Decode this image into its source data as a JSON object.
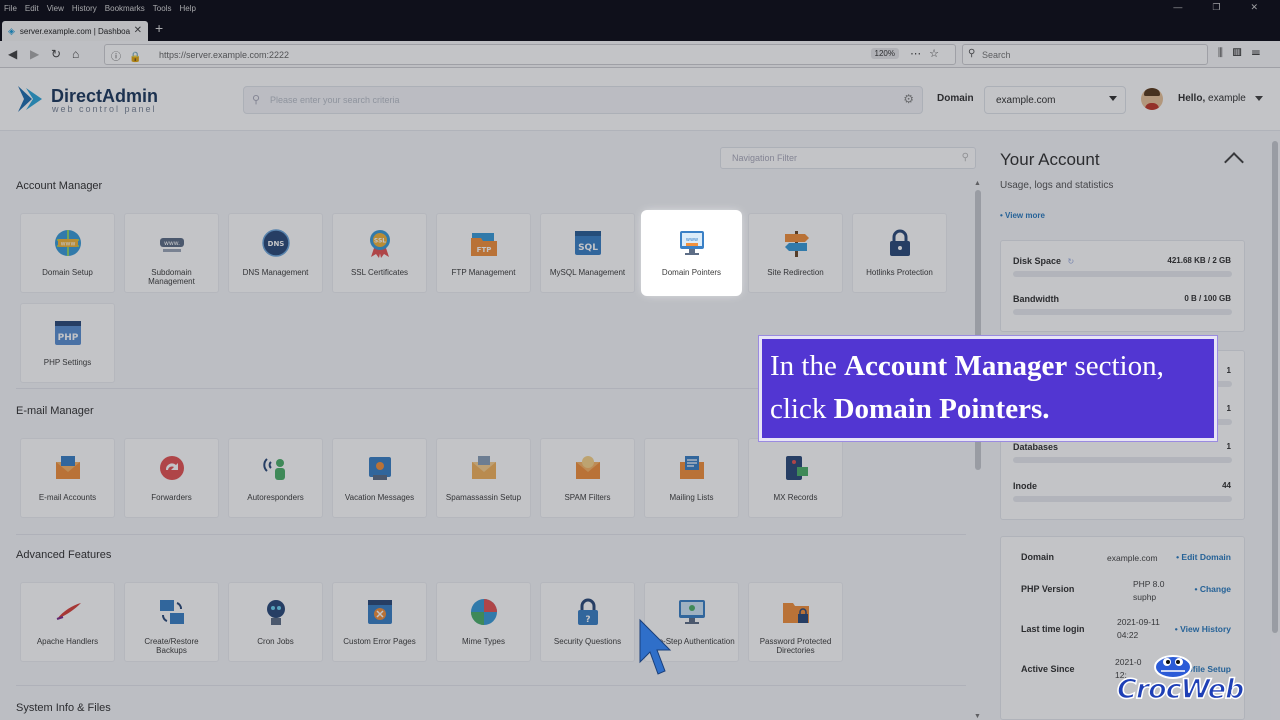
{
  "browser": {
    "menu": [
      "File",
      "Edit",
      "View",
      "History",
      "Bookmarks",
      "Tools",
      "Help"
    ],
    "tab_title": "server.example.com | Dashboa",
    "url": "https://server.example.com:2222",
    "zoom": "120%",
    "search_placeholder": "Search"
  },
  "header": {
    "logo_name": "DirectAdmin",
    "logo_sub": "web control panel",
    "search_placeholder": "Please enter your search criteria",
    "domain_label": "Domain",
    "domain_value": "example.com",
    "hello_prefix": "Hello,",
    "hello_user": "example"
  },
  "nav_filter_placeholder": "Navigation Filter",
  "sections": {
    "account": {
      "title": "Account Manager",
      "items": [
        {
          "label": "Domain Setup",
          "icon": "globe-www-icon"
        },
        {
          "label": "Subdomain Management",
          "icon": "subdomain-icon"
        },
        {
          "label": "DNS Management",
          "icon": "dns-globe-icon"
        },
        {
          "label": "SSL Certificates",
          "icon": "ssl-badge-icon"
        },
        {
          "label": "FTP Management",
          "icon": "ftp-folder-icon"
        },
        {
          "label": "MySQL Management",
          "icon": "sql-window-icon"
        },
        {
          "label": "Domain Pointers",
          "icon": "domain-pointer-monitor-icon"
        },
        {
          "label": "Site Redirection",
          "icon": "signpost-icon"
        },
        {
          "label": "Hotlinks Protection",
          "icon": "padlock-icon"
        },
        {
          "label": "PHP Settings",
          "icon": "php-window-icon"
        }
      ]
    },
    "email": {
      "title": "E-mail Manager",
      "items": [
        {
          "label": "E-mail Accounts",
          "icon": "envelope-icon"
        },
        {
          "label": "Forwarders",
          "icon": "forward-arrow-icon"
        },
        {
          "label": "Autoresponders",
          "icon": "auto-responder-icon"
        },
        {
          "label": "Vacation Messages",
          "icon": "vacation-icon"
        },
        {
          "label": "Spamassassin Setup",
          "icon": "spam-envelope-icon"
        },
        {
          "label": "SPAM Filters",
          "icon": "spam-filter-icon"
        },
        {
          "label": "Mailing Lists",
          "icon": "mailing-list-icon"
        },
        {
          "label": "MX Records",
          "icon": "mx-server-icon"
        }
      ]
    },
    "advanced": {
      "title": "Advanced Features",
      "items": [
        {
          "label": "Apache Handlers",
          "icon": "apache-feather-icon"
        },
        {
          "label": "Create/Restore Backups",
          "icon": "backup-icon"
        },
        {
          "label": "Cron Jobs",
          "icon": "cron-robot-icon"
        },
        {
          "label": "Custom Error Pages",
          "icon": "error-page-icon"
        },
        {
          "label": "Mime Types",
          "icon": "mime-types-icon"
        },
        {
          "label": "Security Questions",
          "icon": "security-lock-icon"
        },
        {
          "label": "Two-Step Authentication",
          "icon": "two-step-monitor-icon"
        },
        {
          "label": "Password Protected Directories",
          "icon": "protected-folder-icon"
        }
      ]
    },
    "system": {
      "title": "System Info & Files"
    }
  },
  "account_panel": {
    "title": "Your Account",
    "subtitle": "Usage, logs and statistics",
    "view_more": "• View more",
    "stats": [
      {
        "name": "Disk Space",
        "value": "421.68 KB / 2 GB"
      },
      {
        "name": "Bandwidth",
        "value": "0 B / 100 GB"
      },
      {
        "name": "",
        "value": "1"
      },
      {
        "name": "",
        "value": "1"
      },
      {
        "name": "Databases",
        "value": "1"
      },
      {
        "name": "Inode",
        "value": "44"
      }
    ],
    "info": [
      {
        "name": "Domain",
        "value": "example.com",
        "link": "• Edit Domain"
      },
      {
        "name": "PHP Version",
        "value": "PHP 8.0\nsuphp",
        "link": "• Change"
      },
      {
        "name": "Last time login",
        "value": "2021-09-11\n04:22",
        "link": "• View History"
      },
      {
        "name": "Active Since",
        "value": "2021-0\n12:",
        "link": "ofile Setup"
      }
    ]
  },
  "callout": {
    "line1_pre": "In the",
    "line1_bold": "Account Manager",
    "line1_post": "section,",
    "line2_pre": "click",
    "line2_bold": "Domain Pointers."
  },
  "watermark": "CrocWeb",
  "highlight": "Domain Pointers",
  "colors": {
    "accent": "#2b7bbf",
    "callout": "#5236d2",
    "brand": "#1e3a5f"
  }
}
